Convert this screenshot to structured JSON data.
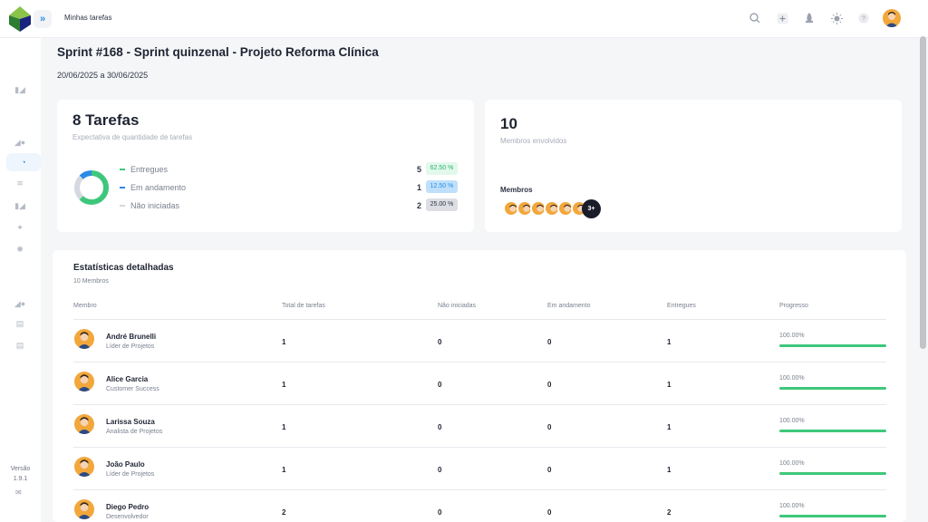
{
  "header": {
    "breadcrumb": "Minhas tarefas"
  },
  "icons": {
    "search": "search-icon",
    "add": "add-icon",
    "rocket": "rocket-icon",
    "theme": "sun-icon",
    "help": "help-icon"
  },
  "sidebar": {
    "version_label": "Versão",
    "version": "1.9.1"
  },
  "sprint": {
    "title": "Sprint #168 - Sprint quinzenal - Projeto Reforma Clínica",
    "dates": "20/06/2025 a 30/06/2025"
  },
  "tasks_card": {
    "count": "8 Tarefas",
    "subtitle": "Expectativa de quantidade de tarefas",
    "rows": [
      {
        "label": "Entregues",
        "count": "5",
        "pct": "62.50 %",
        "value": 62.5,
        "color": "#3ec77b",
        "badge_bg": "#e3f8ec",
        "badge_fg": "#2fb56a"
      },
      {
        "label": "Em andamento",
        "count": "1",
        "pct": "12.50 %",
        "value": 12.5,
        "color": "#2b8be6",
        "badge_bg": "#bfe0fb",
        "badge_fg": "#2b8be6"
      },
      {
        "label": "Não iniciadas",
        "count": "2",
        "pct": "25.00 %",
        "value": 25,
        "color": "#d5d8de",
        "badge_bg": "#dcdee3",
        "badge_fg": "#2e3444"
      }
    ]
  },
  "members_card": {
    "count": "10",
    "subtitle": "Membros envolvidos",
    "label": "Membros",
    "more": "3+"
  },
  "stats": {
    "title": "Estatísticas detalhadas",
    "subtitle": "10 Membros",
    "columns": [
      "Membro",
      "Total de tarefas",
      "Não iniciadas",
      "Em andamento",
      "Entregues",
      "Progresso"
    ],
    "rows": [
      {
        "name": "André Brunelli",
        "role": "Líder de Projetos",
        "total": "1",
        "not_started": "0",
        "in_progress": "0",
        "delivered": "1",
        "progress": "100.00%",
        "value": 100
      },
      {
        "name": "Alice Garcia",
        "role": "Customer Success",
        "total": "1",
        "not_started": "0",
        "in_progress": "0",
        "delivered": "1",
        "progress": "100.00%",
        "value": 100
      },
      {
        "name": "Larissa Souza",
        "role": "Analista de Projetos",
        "total": "1",
        "not_started": "0",
        "in_progress": "0",
        "delivered": "1",
        "progress": "100.00%",
        "value": 100
      },
      {
        "name": "João Paulo",
        "role": "Líder de Projetos",
        "total": "1",
        "not_started": "0",
        "in_progress": "0",
        "delivered": "1",
        "progress": "100.00%",
        "value": 100
      },
      {
        "name": "Diego Pedro",
        "role": "Desenvolvedor",
        "total": "2",
        "not_started": "0",
        "in_progress": "0",
        "delivered": "2",
        "progress": "100.00%",
        "value": 100
      }
    ]
  }
}
